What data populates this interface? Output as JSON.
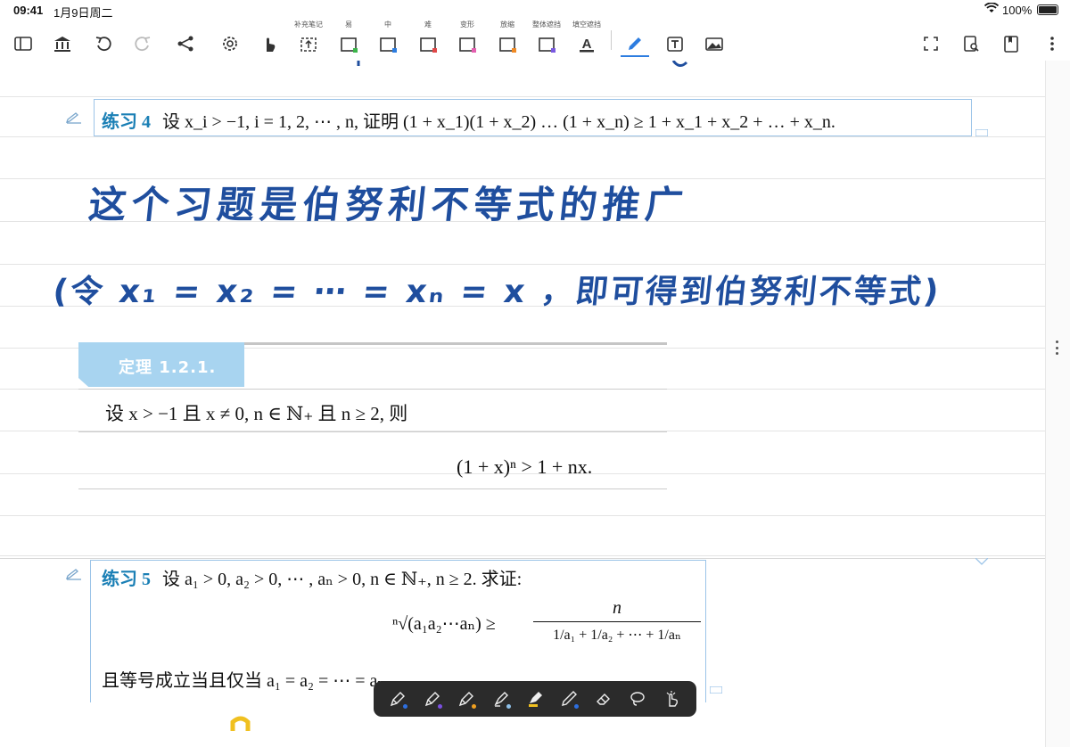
{
  "status_bar": {
    "time": "09:41",
    "date": "1月9日周二",
    "battery": "100%"
  },
  "toolbar": {
    "captions": [
      "补充笔记",
      "易",
      "中",
      "难",
      "变形",
      "放缩",
      "整体遮挡",
      "填空遮挡"
    ],
    "caption_colors": [
      "#e04848",
      "#3bb54a",
      "#2d7de0",
      "#e45fb0",
      "#f08a24",
      "#7a5ae0"
    ],
    "active_color": "#2d7de0"
  },
  "exercise4": {
    "label": "练习 4",
    "text": "设 x_i > −1, i = 1, 2, ⋯ , n, 证明 (1 + x_1)(1 + x_2) … (1 + x_n) ≥ 1 + x_1 + x_2 + … + x_n."
  },
  "handwriting": {
    "line1": "这个习题是伯努利不等式的推广",
    "line2": "(令 x₁ = x₂ = ⋯ = xₙ = x ，即可得到伯努利不等式)"
  },
  "theorem": {
    "title": "定理 1.2.1.",
    "condition": "设 x > −1 且 x ≠ 0, n ∈ ℕ₊ 且 n ≥ 2, 则",
    "formula": "(1 + x)ⁿ > 1 + nx."
  },
  "exercise5": {
    "label": "练习 5",
    "text": "设 a₁ > 0, a₂ > 0, ⋯ , aₙ > 0, n ∈ ℕ₊, n ≥ 2. 求证:",
    "formula_left": "ⁿ√(a₁a₂⋯aₙ) ≥",
    "formula_num": "n",
    "formula_den": "1/a₁ + 1/a₂ + ⋯ + 1/aₙ",
    "tail": "且等号成立当且仅当 a₁ = a₂ = ⋯ = aₙ"
  },
  "drawbar": {
    "tools": [
      "pen-1",
      "pen-2",
      "pen-3",
      "highlighter",
      "marker",
      "pencil",
      "eraser",
      "lasso",
      "hand"
    ],
    "dot_colors": [
      "#2d6fe0",
      "#7a4fe0",
      "#f0a020",
      "#8ec0e8",
      "#f0c020",
      "#2d6fe0"
    ]
  },
  "colors": {
    "accent": "#1a7fb5",
    "ink": "#1f4e9e",
    "theorem": "#a8d4f0"
  }
}
